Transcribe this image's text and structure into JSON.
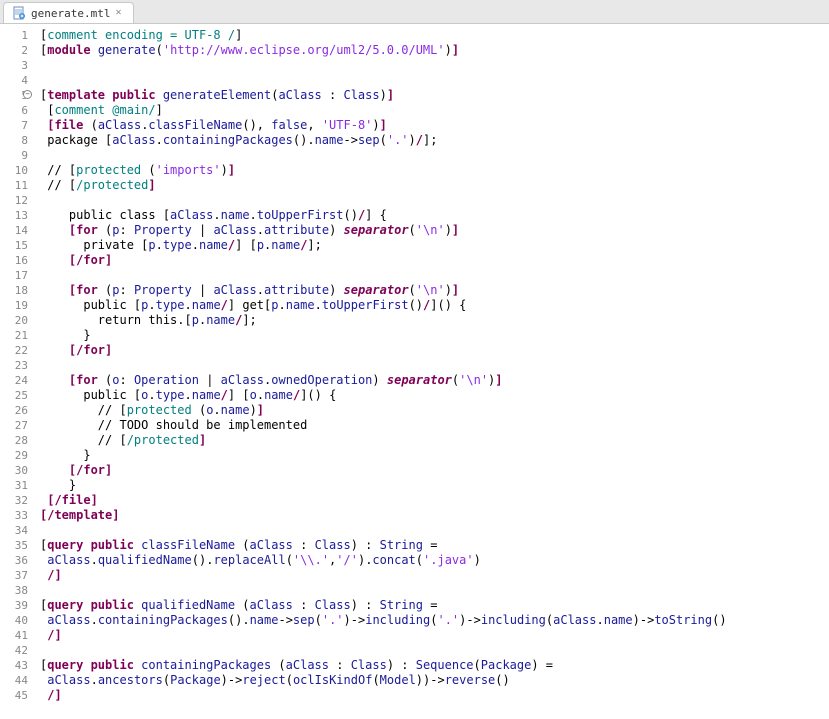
{
  "tab": {
    "title": "generate.mtl"
  },
  "lines": [
    {
      "n": 1,
      "tokens": [
        [
          "txt",
          "["
        ],
        [
          "cmt",
          "comment encoding = UTF-8 /"
        ],
        [
          "txt",
          "]"
        ]
      ]
    },
    {
      "n": 2,
      "tokens": [
        [
          "txt",
          "["
        ],
        [
          "kw1",
          "module "
        ],
        [
          "kw2",
          "generate"
        ],
        [
          "txt",
          "("
        ],
        [
          "str",
          "'http://www.eclipse.org/uml2/5.0.0/UML'"
        ],
        [
          "txt",
          ")"
        ],
        [
          "kw1",
          "]"
        ]
      ]
    },
    {
      "n": 3,
      "tokens": []
    },
    {
      "n": 4,
      "tokens": []
    },
    {
      "n": 5,
      "fold": true,
      "tokens": [
        [
          "txt",
          "["
        ],
        [
          "kw1",
          "template public "
        ],
        [
          "kw2",
          "generateElement"
        ],
        [
          "txt",
          "("
        ],
        [
          "kw2",
          "aClass"
        ],
        [
          "txt",
          " : "
        ],
        [
          "kw2",
          "Class"
        ],
        [
          "txt",
          ")"
        ],
        [
          "kw1",
          "]"
        ]
      ]
    },
    {
      "n": 6,
      "tokens": [
        [
          "txt",
          " ["
        ],
        [
          "cmt",
          "comment "
        ],
        [
          "kw3",
          "@main"
        ],
        [
          "cmt",
          "/"
        ],
        [
          "txt",
          "]"
        ]
      ]
    },
    {
      "n": 7,
      "tokens": [
        [
          "txt",
          " "
        ],
        [
          "kw1",
          "[file "
        ],
        [
          "txt",
          "("
        ],
        [
          "kw2",
          "aClass"
        ],
        [
          "txt",
          "."
        ],
        [
          "kw2",
          "classFileName"
        ],
        [
          "txt",
          "(), "
        ],
        [
          "kw2",
          "false"
        ],
        [
          "txt",
          ", "
        ],
        [
          "str",
          "'UTF-8'"
        ],
        [
          "txt",
          ")"
        ],
        [
          "kw1",
          "]"
        ]
      ]
    },
    {
      "n": 8,
      "tokens": [
        [
          "txt",
          " package ["
        ],
        [
          "kw2",
          "aClass"
        ],
        [
          "txt",
          "."
        ],
        [
          "kw2",
          "containingPackages"
        ],
        [
          "txt",
          "()."
        ],
        [
          "kw2",
          "name"
        ],
        [
          "txt",
          "->"
        ],
        [
          "kw2",
          "sep"
        ],
        [
          "txt",
          "("
        ],
        [
          "str",
          "'.'"
        ],
        [
          "txt",
          ")"
        ],
        [
          "kw1",
          "/"
        ],
        [
          "txt",
          "];"
        ]
      ]
    },
    {
      "n": 9,
      "tokens": []
    },
    {
      "n": 10,
      "tokens": [
        [
          "txt",
          " // ["
        ],
        [
          "cmt",
          "protected "
        ],
        [
          "txt",
          "("
        ],
        [
          "str",
          "'imports'"
        ],
        [
          "txt",
          ")"
        ],
        [
          "kw1",
          "]"
        ]
      ]
    },
    {
      "n": 11,
      "tokens": [
        [
          "txt",
          " // ["
        ],
        [
          "cmt",
          "/protected"
        ],
        [
          "kw1",
          "]"
        ]
      ]
    },
    {
      "n": 12,
      "tokens": []
    },
    {
      "n": 13,
      "tokens": [
        [
          "txt",
          "    public class ["
        ],
        [
          "kw2",
          "aClass"
        ],
        [
          "txt",
          "."
        ],
        [
          "kw2",
          "name"
        ],
        [
          "txt",
          "."
        ],
        [
          "kw2",
          "toUpperFirst"
        ],
        [
          "txt",
          "()"
        ],
        [
          "kw1",
          "/"
        ],
        [
          "txt",
          "] {"
        ]
      ]
    },
    {
      "n": 14,
      "tokens": [
        [
          "txt",
          "    "
        ],
        [
          "kw1",
          "[for "
        ],
        [
          "txt",
          "("
        ],
        [
          "kw2",
          "p"
        ],
        [
          "txt",
          ": "
        ],
        [
          "kw2",
          "Property"
        ],
        [
          "txt",
          " | "
        ],
        [
          "kw2",
          "aClass"
        ],
        [
          "txt",
          "."
        ],
        [
          "kw2",
          "attribute"
        ],
        [
          "txt",
          ") "
        ],
        [
          "kw1i",
          "separator"
        ],
        [
          "txt",
          "("
        ],
        [
          "str",
          "'\\n'"
        ],
        [
          "txt",
          ")"
        ],
        [
          "kw1",
          "]"
        ]
      ]
    },
    {
      "n": 15,
      "tokens": [
        [
          "txt",
          "      private ["
        ],
        [
          "kw2",
          "p"
        ],
        [
          "txt",
          "."
        ],
        [
          "kw2",
          "type"
        ],
        [
          "txt",
          "."
        ],
        [
          "kw2",
          "name"
        ],
        [
          "kw1",
          "/"
        ],
        [
          "txt",
          "] ["
        ],
        [
          "kw2",
          "p"
        ],
        [
          "txt",
          "."
        ],
        [
          "kw2",
          "name"
        ],
        [
          "kw1",
          "/"
        ],
        [
          "txt",
          "];"
        ]
      ]
    },
    {
      "n": 16,
      "tokens": [
        [
          "txt",
          "    "
        ],
        [
          "kw1",
          "[/for]"
        ]
      ]
    },
    {
      "n": 17,
      "tokens": []
    },
    {
      "n": 18,
      "tokens": [
        [
          "txt",
          "    "
        ],
        [
          "kw1",
          "[for "
        ],
        [
          "txt",
          "("
        ],
        [
          "kw2",
          "p"
        ],
        [
          "txt",
          ": "
        ],
        [
          "kw2",
          "Property"
        ],
        [
          "txt",
          " | "
        ],
        [
          "kw2",
          "aClass"
        ],
        [
          "txt",
          "."
        ],
        [
          "kw2",
          "attribute"
        ],
        [
          "txt",
          ") "
        ],
        [
          "kw1i",
          "separator"
        ],
        [
          "txt",
          "("
        ],
        [
          "str",
          "'\\n'"
        ],
        [
          "txt",
          ")"
        ],
        [
          "kw1",
          "]"
        ]
      ]
    },
    {
      "n": 19,
      "tokens": [
        [
          "txt",
          "      public ["
        ],
        [
          "kw2",
          "p"
        ],
        [
          "txt",
          "."
        ],
        [
          "kw2",
          "type"
        ],
        [
          "txt",
          "."
        ],
        [
          "kw2",
          "name"
        ],
        [
          "kw1",
          "/"
        ],
        [
          "txt",
          "] get["
        ],
        [
          "kw2",
          "p"
        ],
        [
          "txt",
          "."
        ],
        [
          "kw2",
          "name"
        ],
        [
          "txt",
          "."
        ],
        [
          "kw2",
          "toUpperFirst"
        ],
        [
          "txt",
          "()"
        ],
        [
          "kw1",
          "/"
        ],
        [
          "txt",
          "]() {"
        ]
      ]
    },
    {
      "n": 20,
      "tokens": [
        [
          "txt",
          "        return this.["
        ],
        [
          "kw2",
          "p"
        ],
        [
          "txt",
          "."
        ],
        [
          "kw2",
          "name"
        ],
        [
          "kw1",
          "/"
        ],
        [
          "txt",
          "];"
        ]
      ]
    },
    {
      "n": 21,
      "tokens": [
        [
          "txt",
          "      }"
        ]
      ]
    },
    {
      "n": 22,
      "tokens": [
        [
          "txt",
          "    "
        ],
        [
          "kw1",
          "[/for]"
        ]
      ]
    },
    {
      "n": 23,
      "tokens": []
    },
    {
      "n": 24,
      "tokens": [
        [
          "txt",
          "    "
        ],
        [
          "kw1",
          "[for "
        ],
        [
          "txt",
          "("
        ],
        [
          "kw2",
          "o"
        ],
        [
          "txt",
          ": "
        ],
        [
          "kw2",
          "Operation"
        ],
        [
          "txt",
          " | "
        ],
        [
          "kw2",
          "aClass"
        ],
        [
          "txt",
          "."
        ],
        [
          "kw2",
          "ownedOperation"
        ],
        [
          "txt",
          ") "
        ],
        [
          "kw1i",
          "separator"
        ],
        [
          "txt",
          "("
        ],
        [
          "str",
          "'\\n'"
        ],
        [
          "txt",
          ")"
        ],
        [
          "kw1",
          "]"
        ]
      ]
    },
    {
      "n": 25,
      "tokens": [
        [
          "txt",
          "      public ["
        ],
        [
          "kw2",
          "o"
        ],
        [
          "txt",
          "."
        ],
        [
          "kw2",
          "type"
        ],
        [
          "txt",
          "."
        ],
        [
          "kw2",
          "name"
        ],
        [
          "kw1",
          "/"
        ],
        [
          "txt",
          "] ["
        ],
        [
          "kw2",
          "o"
        ],
        [
          "txt",
          "."
        ],
        [
          "kw2",
          "name"
        ],
        [
          "kw1",
          "/"
        ],
        [
          "txt",
          "]() {"
        ]
      ]
    },
    {
      "n": 26,
      "tokens": [
        [
          "txt",
          "        // ["
        ],
        [
          "cmt",
          "protected "
        ],
        [
          "txt",
          "("
        ],
        [
          "kw2",
          "o"
        ],
        [
          "txt",
          "."
        ],
        [
          "kw2",
          "name"
        ],
        [
          "txt",
          ")"
        ],
        [
          "kw1",
          "]"
        ]
      ]
    },
    {
      "n": 27,
      "tokens": [
        [
          "txt",
          "        // TODO should be implemented"
        ]
      ]
    },
    {
      "n": 28,
      "tokens": [
        [
          "txt",
          "        // ["
        ],
        [
          "cmt",
          "/protected"
        ],
        [
          "kw1",
          "]"
        ]
      ]
    },
    {
      "n": 29,
      "tokens": [
        [
          "txt",
          "      }"
        ]
      ]
    },
    {
      "n": 30,
      "tokens": [
        [
          "txt",
          "    "
        ],
        [
          "kw1",
          "[/for]"
        ]
      ]
    },
    {
      "n": 31,
      "tokens": [
        [
          "txt",
          "    }"
        ]
      ]
    },
    {
      "n": 32,
      "tokens": [
        [
          "txt",
          " "
        ],
        [
          "kw1",
          "[/file]"
        ]
      ]
    },
    {
      "n": 33,
      "tokens": [
        [
          "kw1",
          "[/template]"
        ]
      ]
    },
    {
      "n": 34,
      "tokens": []
    },
    {
      "n": 35,
      "tokens": [
        [
          "txt",
          "["
        ],
        [
          "kw1",
          "query public "
        ],
        [
          "kw2",
          "classFileName"
        ],
        [
          "txt",
          " ("
        ],
        [
          "kw2",
          "aClass"
        ],
        [
          "txt",
          " : "
        ],
        [
          "kw2",
          "Class"
        ],
        [
          "txt",
          ") : "
        ],
        [
          "kw2",
          "String"
        ],
        [
          "txt",
          " ="
        ]
      ]
    },
    {
      "n": 36,
      "tokens": [
        [
          "txt",
          " "
        ],
        [
          "kw2",
          "aClass"
        ],
        [
          "txt",
          "."
        ],
        [
          "kw2",
          "qualifiedName"
        ],
        [
          "txt",
          "()."
        ],
        [
          "kw2",
          "replaceAll"
        ],
        [
          "txt",
          "("
        ],
        [
          "str",
          "'\\\\.'"
        ],
        [
          "txt",
          ","
        ],
        [
          "str",
          "'/'"
        ],
        [
          "txt",
          ")."
        ],
        [
          "kw2",
          "concat"
        ],
        [
          "txt",
          "("
        ],
        [
          "str",
          "'.java'"
        ],
        [
          "txt",
          ")"
        ]
      ]
    },
    {
      "n": 37,
      "tokens": [
        [
          "txt",
          " "
        ],
        [
          "kw1",
          "/]"
        ]
      ]
    },
    {
      "n": 38,
      "tokens": []
    },
    {
      "n": 39,
      "tokens": [
        [
          "txt",
          "["
        ],
        [
          "kw1",
          "query public "
        ],
        [
          "kw2",
          "qualifiedName"
        ],
        [
          "txt",
          " ("
        ],
        [
          "kw2",
          "aClass"
        ],
        [
          "txt",
          " : "
        ],
        [
          "kw2",
          "Class"
        ],
        [
          "txt",
          ") : "
        ],
        [
          "kw2",
          "String"
        ],
        [
          "txt",
          " ="
        ]
      ]
    },
    {
      "n": 40,
      "tokens": [
        [
          "txt",
          " "
        ],
        [
          "kw2",
          "aClass"
        ],
        [
          "txt",
          "."
        ],
        [
          "kw2",
          "containingPackages"
        ],
        [
          "txt",
          "()."
        ],
        [
          "kw2",
          "name"
        ],
        [
          "txt",
          "->"
        ],
        [
          "kw2",
          "sep"
        ],
        [
          "txt",
          "("
        ],
        [
          "str",
          "'.'"
        ],
        [
          "txt",
          ")->"
        ],
        [
          "kw2",
          "including"
        ],
        [
          "txt",
          "("
        ],
        [
          "str",
          "'.'"
        ],
        [
          "txt",
          ")->"
        ],
        [
          "kw2",
          "including"
        ],
        [
          "txt",
          "("
        ],
        [
          "kw2",
          "aClass"
        ],
        [
          "txt",
          "."
        ],
        [
          "kw2",
          "name"
        ],
        [
          "txt",
          ")->"
        ],
        [
          "kw2",
          "toString"
        ],
        [
          "txt",
          "()"
        ]
      ]
    },
    {
      "n": 41,
      "tokens": [
        [
          "txt",
          " "
        ],
        [
          "kw1",
          "/]"
        ]
      ]
    },
    {
      "n": 42,
      "tokens": []
    },
    {
      "n": 43,
      "tokens": [
        [
          "txt",
          "["
        ],
        [
          "kw1",
          "query public "
        ],
        [
          "kw2",
          "containingPackages"
        ],
        [
          "txt",
          " ("
        ],
        [
          "kw2",
          "aClass"
        ],
        [
          "txt",
          " : "
        ],
        [
          "kw2",
          "Class"
        ],
        [
          "txt",
          ") : "
        ],
        [
          "kw2",
          "Sequence"
        ],
        [
          "txt",
          "("
        ],
        [
          "kw2",
          "Package"
        ],
        [
          "txt",
          ") ="
        ]
      ]
    },
    {
      "n": 44,
      "tokens": [
        [
          "txt",
          " "
        ],
        [
          "kw2",
          "aClass"
        ],
        [
          "txt",
          "."
        ],
        [
          "kw2",
          "ancestors"
        ],
        [
          "txt",
          "("
        ],
        [
          "kw2",
          "Package"
        ],
        [
          "txt",
          ")->"
        ],
        [
          "kw2",
          "reject"
        ],
        [
          "txt",
          "("
        ],
        [
          "kw2",
          "oclIsKindOf"
        ],
        [
          "txt",
          "("
        ],
        [
          "kw2",
          "Model"
        ],
        [
          "txt",
          "))->"
        ],
        [
          "kw2",
          "reverse"
        ],
        [
          "txt",
          "()"
        ]
      ]
    },
    {
      "n": 45,
      "tokens": [
        [
          "txt",
          " "
        ],
        [
          "kw1",
          "/]"
        ]
      ]
    }
  ]
}
